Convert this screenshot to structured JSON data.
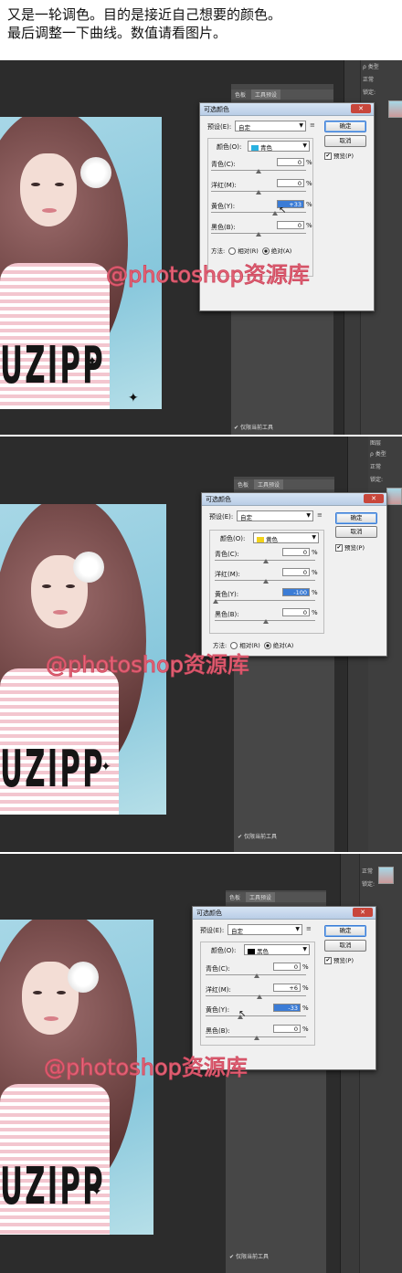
{
  "intro": {
    "line1": "又是一轮调色。目的是接近自己想要的颜色。",
    "line2": "最后调整一下曲线。数值请看图片。"
  },
  "watermark": "@photoshop资源库",
  "photo_text": "UZIPP",
  "ps_ui": {
    "tab_color": "色板",
    "tab_preset": "工具预设",
    "layers_tab": "图层",
    "layers_kind": "ρ 类型",
    "blend_normal": "正常",
    "lock_label": "锁定:",
    "current_tool_only": "仅限当前工具"
  },
  "dialog": {
    "title": "可选颜色",
    "preset_label": "预设(E):",
    "preset_value": "自定",
    "colors_label": "颜色(O):",
    "cyan_label": "青色(C):",
    "magenta_label": "洋红(M):",
    "yellow_label": "黄色(Y):",
    "black_label": "黑色(B):",
    "percent": "%",
    "ok": "确定",
    "cancel": "取消",
    "preview": "预览(P)",
    "method_label": "方法:",
    "relative": "相对(R)",
    "absolute": "绝对(A)"
  },
  "steps": [
    {
      "color_name": "青色",
      "swatch": "#29b1e0",
      "cyan": "0",
      "magenta": "0",
      "yellow": "+33",
      "black": "0",
      "selected": "yellow"
    },
    {
      "color_name": "黄色",
      "swatch": "#f2d21a",
      "cyan": "0",
      "magenta": "0",
      "yellow": "-100",
      "black": "0",
      "selected": "yellow"
    },
    {
      "color_name": "黑色",
      "swatch": "#000000",
      "cyan": "0",
      "magenta": "+6",
      "yellow": "-33",
      "black": "0",
      "selected": "yellow"
    }
  ]
}
